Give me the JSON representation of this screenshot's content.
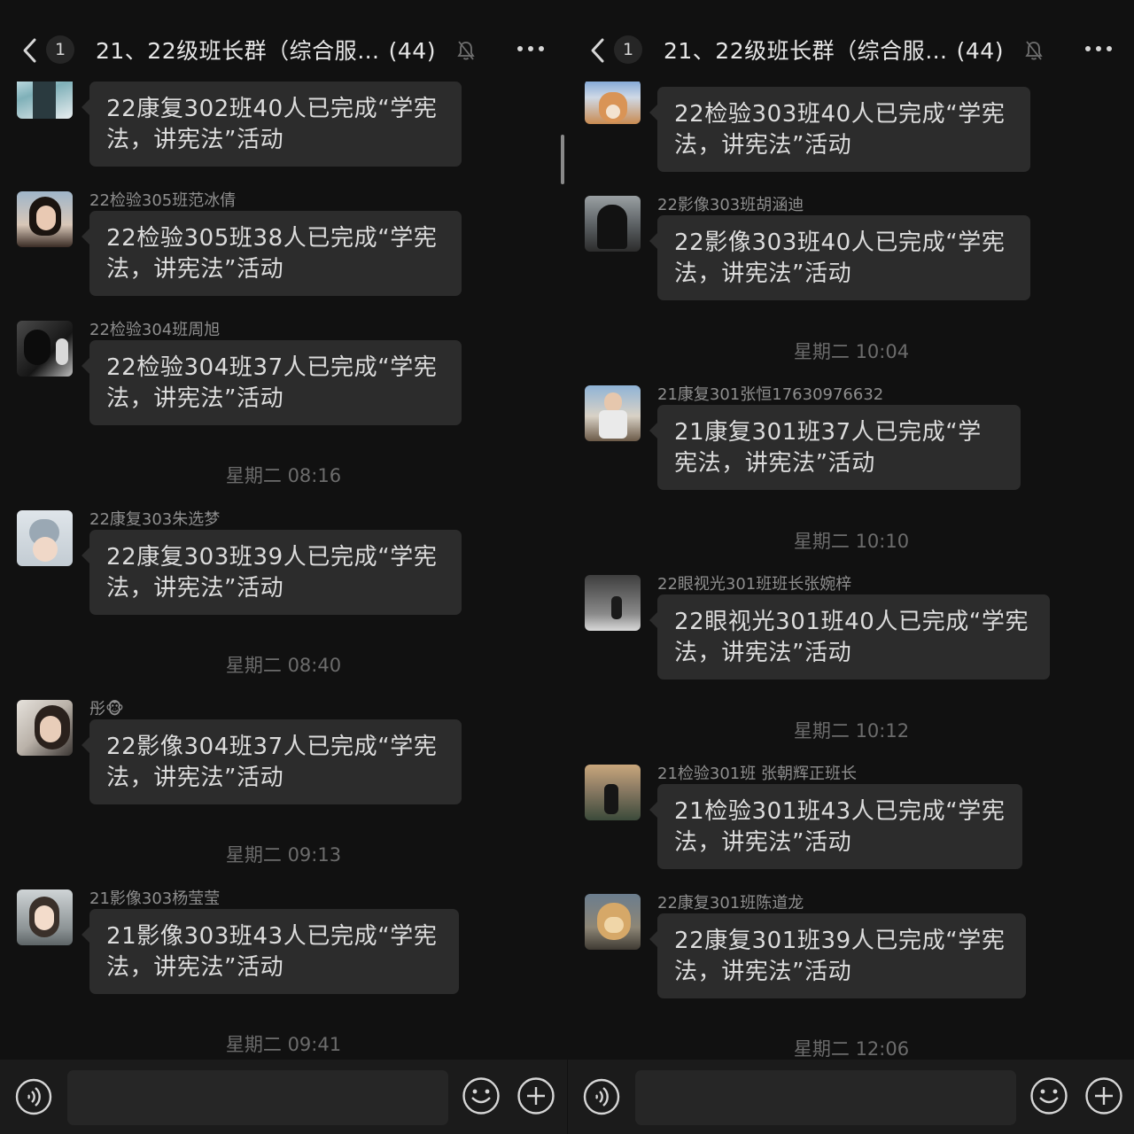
{
  "header": {
    "back_badge": "1",
    "title": "21、22级班长群（综合服…",
    "member_count": "(44)"
  },
  "left": {
    "messages": [
      {
        "sender": "",
        "text": "22康复302班40人已完成“学宪法，讲宪法”活动"
      },
      {
        "sender": "22检验305班范冰倩",
        "text": "22检验305班38人已完成“学宪法，讲宪法”活动"
      },
      {
        "sender": "22检验304班周旭",
        "text": "22检验304班37人已完成“学宪法，讲宪法”活动"
      },
      {
        "sender": "22康复303朱选梦",
        "text": "22康复303班39人已完成“学宪法，讲宪法”活动"
      },
      {
        "sender": "彤🐵",
        "text": "22影像304班37人已完成“学宪法，讲宪法”活动"
      },
      {
        "sender": "21影像303杨莹莹",
        "text": "21影像303班43人已完成“学宪法，讲宪法”活动"
      }
    ],
    "timestamps": [
      "星期二 08:16",
      "星期二 08:40",
      "星期二 09:13",
      "星期二 09:41"
    ]
  },
  "right": {
    "messages": [
      {
        "sender": "",
        "text": "22检验303班40人已完成“学宪法，讲宪法”活动"
      },
      {
        "sender": "22影像303班胡涵迪",
        "text": "22影像303班40人已完成“学宪法，讲宪法”活动"
      },
      {
        "sender": "21康复301张恒17630976632",
        "text": "21康复301班37人已完成“学宪法，讲宪法”活动"
      },
      {
        "sender": "22眼视光301班班长张婉梓",
        "text": "22眼视光301班40人已完成“学宪法，讲宪法”活动"
      },
      {
        "sender": "21检验301班 张朝辉正班长",
        "text": "21检验301班43人已完成“学宪法，讲宪法”活动"
      },
      {
        "sender": "22康复301班陈道龙",
        "text": "22康复301班39人已完成“学宪法，讲宪法”活动"
      }
    ],
    "timestamps": [
      "星期二 10:04",
      "星期二 10:10",
      "星期二 10:12",
      "星期二 12:06"
    ]
  },
  "icons": {
    "back": "chevron-left-icon",
    "mute": "bell-muted-icon",
    "more": "more-dots-icon",
    "voice": "voice-icon",
    "emoji": "emoji-icon",
    "plus": "plus-icon"
  },
  "colors": {
    "background": "#111111",
    "bubble": "#2c2c2c",
    "input_bar": "#1b1b1b",
    "timestamp": "#6c6c6c",
    "sender": "#8e8e8e"
  }
}
